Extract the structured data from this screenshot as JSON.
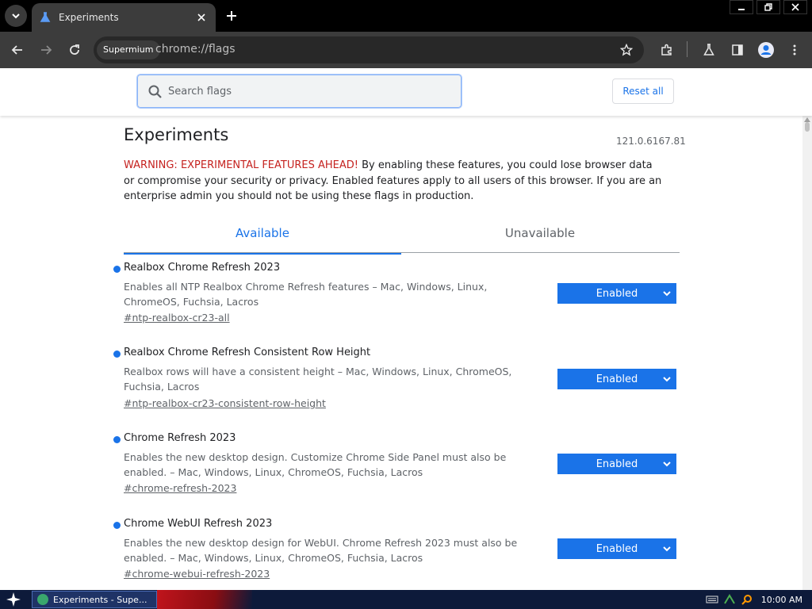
{
  "browser": {
    "tab_title": "Experiments",
    "site_chip": "Supermium",
    "url": "chrome://flags"
  },
  "header": {
    "search_placeholder": "Search flags",
    "reset_label": "Reset all"
  },
  "main": {
    "title": "Experiments",
    "version": "121.0.6167.81",
    "warning_strong": "WARNING: EXPERIMENTAL FEATURES AHEAD!",
    "warning_text": " By enabling these features, you could lose browser data or compromise your security or privacy. Enabled features apply to all users of this browser. If you are an enterprise admin you should not be using these flags in production.",
    "tabs": [
      {
        "label": "Available",
        "active": true
      },
      {
        "label": "Unavailable",
        "active": false
      }
    ],
    "flags": [
      {
        "name": "Realbox Chrome Refresh 2023",
        "description": "Enables all NTP Realbox Chrome Refresh features – Mac, Windows, Linux, ChromeOS, Fuchsia, Lacros",
        "link": "#ntp-realbox-cr23-all",
        "value": "Enabled"
      },
      {
        "name": "Realbox Chrome Refresh Consistent Row Height",
        "description": "Realbox rows will have a consistent height – Mac, Windows, Linux, ChromeOS, Fuchsia, Lacros",
        "link": "#ntp-realbox-cr23-consistent-row-height",
        "value": "Enabled"
      },
      {
        "name": "Chrome Refresh 2023",
        "description": "Enables the new desktop design. Customize Chrome Side Panel must also be enabled. – Mac, Windows, Linux, ChromeOS, Fuchsia, Lacros",
        "link": "#chrome-refresh-2023",
        "value": "Enabled"
      },
      {
        "name": "Chrome WebUI Refresh 2023",
        "description": "Enables the new desktop design for WebUI. Chrome Refresh 2023 must also be enabled. – Mac, Windows, Linux, ChromeOS, Fuchsia, Lacros",
        "link": "#chrome-webui-refresh-2023",
        "value": "Enabled"
      }
    ]
  },
  "taskbar": {
    "task_label": "Experiments - Supe...",
    "clock": "10:00 AM"
  },
  "colors": {
    "accent": "#1a73e8",
    "warning": "#c5221f"
  },
  "icons": [
    "tab-search-icon",
    "flask-icon",
    "close-icon",
    "plus-icon",
    "back-icon",
    "forward-icon",
    "reload-icon",
    "star-icon",
    "extensions-icon",
    "labs-icon",
    "side-panel-icon",
    "profile-icon",
    "menu-icon",
    "search-icon",
    "chevron-down-icon"
  ]
}
